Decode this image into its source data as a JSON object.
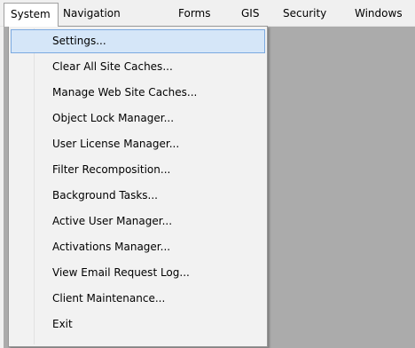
{
  "menubar": {
    "items": [
      {
        "label": "System",
        "open": true
      },
      {
        "label": "Navigation"
      },
      {
        "label": "Forms"
      },
      {
        "label": "GIS"
      },
      {
        "label": "Security"
      },
      {
        "label": "Windows"
      }
    ]
  },
  "system_menu": {
    "items": [
      {
        "label": "Settings...",
        "highlighted": true
      },
      {
        "label": "Clear All Site Caches..."
      },
      {
        "label": "Manage Web Site Caches..."
      },
      {
        "label": "Object Lock Manager..."
      },
      {
        "label": "User License Manager..."
      },
      {
        "label": "Filter Recomposition..."
      },
      {
        "label": "Background Tasks..."
      },
      {
        "label": "Active User Manager..."
      },
      {
        "label": "Activations Manager..."
      },
      {
        "label": "View Email Request Log..."
      },
      {
        "label": "Client Maintenance..."
      },
      {
        "label": "Exit"
      }
    ]
  },
  "colors": {
    "menubar_bg": "#f0f0f0",
    "menu_bg": "#f2f2f2",
    "highlight_bg": "#d5e6f8",
    "highlight_border": "#7aa9e0",
    "workspace_bg": "#ababab"
  }
}
